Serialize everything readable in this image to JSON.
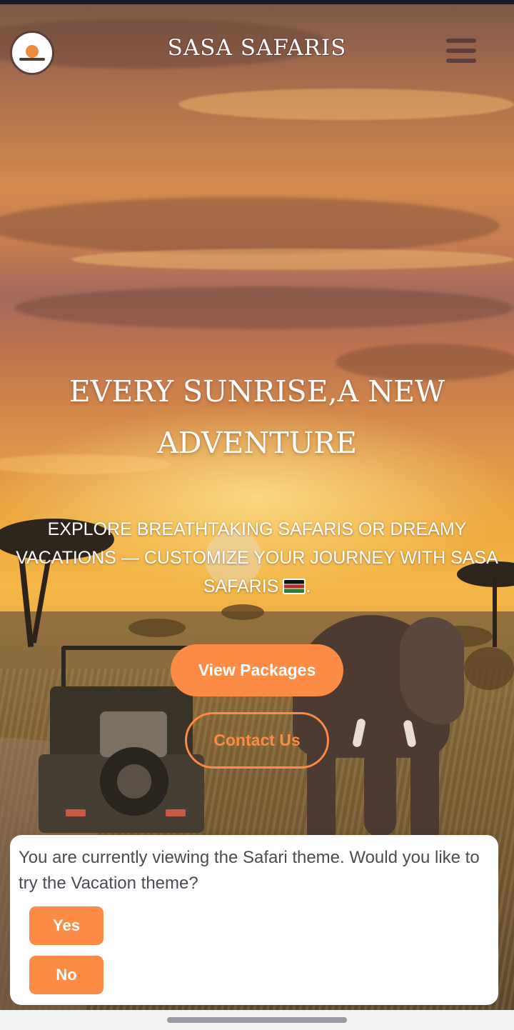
{
  "header": {
    "site_title": "SASA SAFARIS",
    "logo_icon": "elephant-sunrise-logo",
    "menu_icon": "hamburger-menu-icon"
  },
  "hero": {
    "title": "EVERY SUNRISE,A NEW ADVENTURE",
    "subtitle": "EXPLORE BREATHTAKING SAFARIS OR DREAMY VACATIONS — CUSTOMIZE YOUR JOURNEY WITH SASA SAFARIS",
    "subtitle_suffix": ".",
    "flag_icon": "kenya-flag-icon",
    "primary_button": "View Packages",
    "secondary_button": "Contact Us"
  },
  "theme_prompt": {
    "message": "You are currently viewing the Safari theme. Would you like to try the Vacation theme?",
    "yes_label": "Yes",
    "no_label": "No"
  },
  "colors": {
    "accent": "#fb8b45",
    "brand_brown": "#5c3f39",
    "dialog_text": "#4b4b55"
  }
}
